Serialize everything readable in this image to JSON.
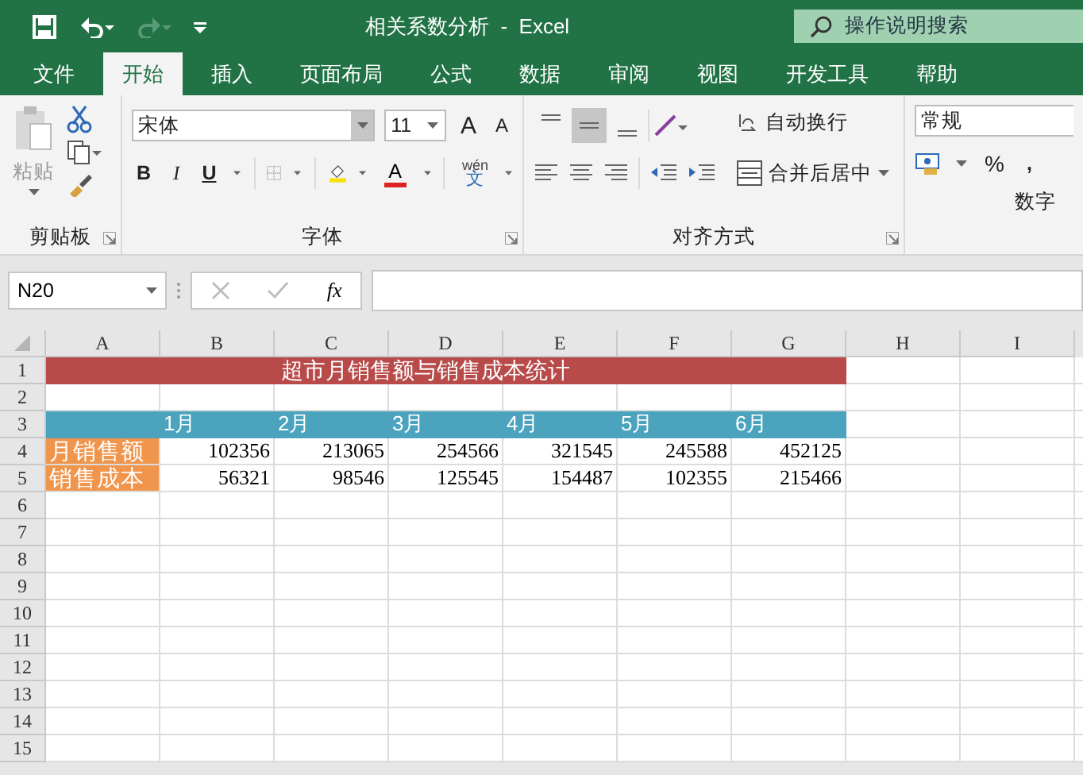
{
  "window": {
    "title": "相关系数分析  -  Excel",
    "search": {
      "placeholder": "操作说明搜索"
    }
  },
  "tabs": [
    {
      "label": "文件",
      "selected": false
    },
    {
      "label": "开始",
      "selected": true
    },
    {
      "label": "插入",
      "selected": false
    },
    {
      "label": "页面布局",
      "selected": false
    },
    {
      "label": "公式",
      "selected": false
    },
    {
      "label": "数据",
      "selected": false
    },
    {
      "label": "审阅",
      "selected": false
    },
    {
      "label": "视图",
      "selected": false
    },
    {
      "label": "开发工具",
      "selected": false
    },
    {
      "label": "帮助",
      "selected": false
    }
  ],
  "ribbon": {
    "clipboard": {
      "paste": "粘贴",
      "label": "剪贴板"
    },
    "font": {
      "font_name": "宋体",
      "font_size": "11",
      "grow": "A",
      "shrink": "A",
      "bold": "B",
      "italic": "I",
      "underline": "U",
      "font_color": "A",
      "phonetic": "wén",
      "phonetic_char": "文",
      "label": "字体"
    },
    "alignment": {
      "vertical_align": [
        {
          "selected": false
        },
        {
          "selected": true
        },
        {
          "selected": false
        }
      ],
      "wrap_text": "自动换行",
      "merge_center": "合并后居中",
      "label": "对齐方式"
    },
    "number": {
      "format": "常规",
      "percent": "%",
      "comma": ",",
      "label": "数字"
    }
  },
  "formula_bar": {
    "name_box": "N20",
    "fx": "fx"
  },
  "sheet": {
    "columns": [
      "A",
      "B",
      "C",
      "D",
      "E",
      "F",
      "G",
      "H",
      "I"
    ],
    "rows": [
      {
        "header": "1",
        "cells": [
          {
            "kind": "title",
            "color": "#b84a4a"
          },
          {
            "kind": "title",
            "color": "#b84a4a"
          },
          {
            "kind": "title",
            "text": "超市月销售额与销售成本统计",
            "color": "#b84a4a"
          },
          {
            "kind": "title",
            "color": "#b84a4a"
          },
          {
            "kind": "title",
            "color": "#b84a4a"
          },
          {
            "kind": "title",
            "color": "#b84a4a"
          },
          {
            "kind": "title",
            "color": "#b84a4a"
          }
        ]
      },
      {
        "header": "2",
        "cells": []
      },
      {
        "header": "3",
        "cells": [
          {
            "kind": "header",
            "color": "#4ba3bd"
          },
          {
            "kind": "header",
            "text": "1月",
            "color": "#4ba3bd"
          },
          {
            "kind": "header",
            "text": "2月",
            "color": "#4ba3bd"
          },
          {
            "kind": "header",
            "text": "3月",
            "color": "#4ba3bd"
          },
          {
            "kind": "header",
            "text": "4月",
            "color": "#4ba3bd"
          },
          {
            "kind": "header",
            "text": "5月",
            "color": "#4ba3bd"
          },
          {
            "kind": "header",
            "text": "6月",
            "color": "#4ba3bd"
          }
        ]
      },
      {
        "header": "4",
        "cells": [
          {
            "kind": "label",
            "text": "月销售额",
            "color": "#f0954c"
          },
          {
            "kind": "number",
            "text": "102356"
          },
          {
            "kind": "number",
            "text": "213065"
          },
          {
            "kind": "number",
            "text": "254566"
          },
          {
            "kind": "number",
            "text": "321545"
          },
          {
            "kind": "number",
            "text": "245588"
          },
          {
            "kind": "number",
            "text": "452125"
          }
        ]
      },
      {
        "header": "5",
        "cells": [
          {
            "kind": "label",
            "text": "销售成本",
            "color": "#f0954c"
          },
          {
            "kind": "number",
            "text": "56321"
          },
          {
            "kind": "number",
            "text": "98546"
          },
          {
            "kind": "number",
            "text": "125545"
          },
          {
            "kind": "number",
            "text": "154487"
          },
          {
            "kind": "number",
            "text": "102355"
          },
          {
            "kind": "number",
            "text": "215466"
          }
        ]
      },
      {
        "header": "6",
        "cells": []
      },
      {
        "header": "7",
        "cells": []
      },
      {
        "header": "8",
        "cells": []
      },
      {
        "header": "9",
        "cells": []
      },
      {
        "header": "10",
        "cells": []
      },
      {
        "header": "11",
        "cells": []
      },
      {
        "header": "12",
        "cells": []
      },
      {
        "header": "13",
        "cells": []
      },
      {
        "header": "14",
        "cells": []
      },
      {
        "header": "15",
        "cells": []
      }
    ]
  }
}
